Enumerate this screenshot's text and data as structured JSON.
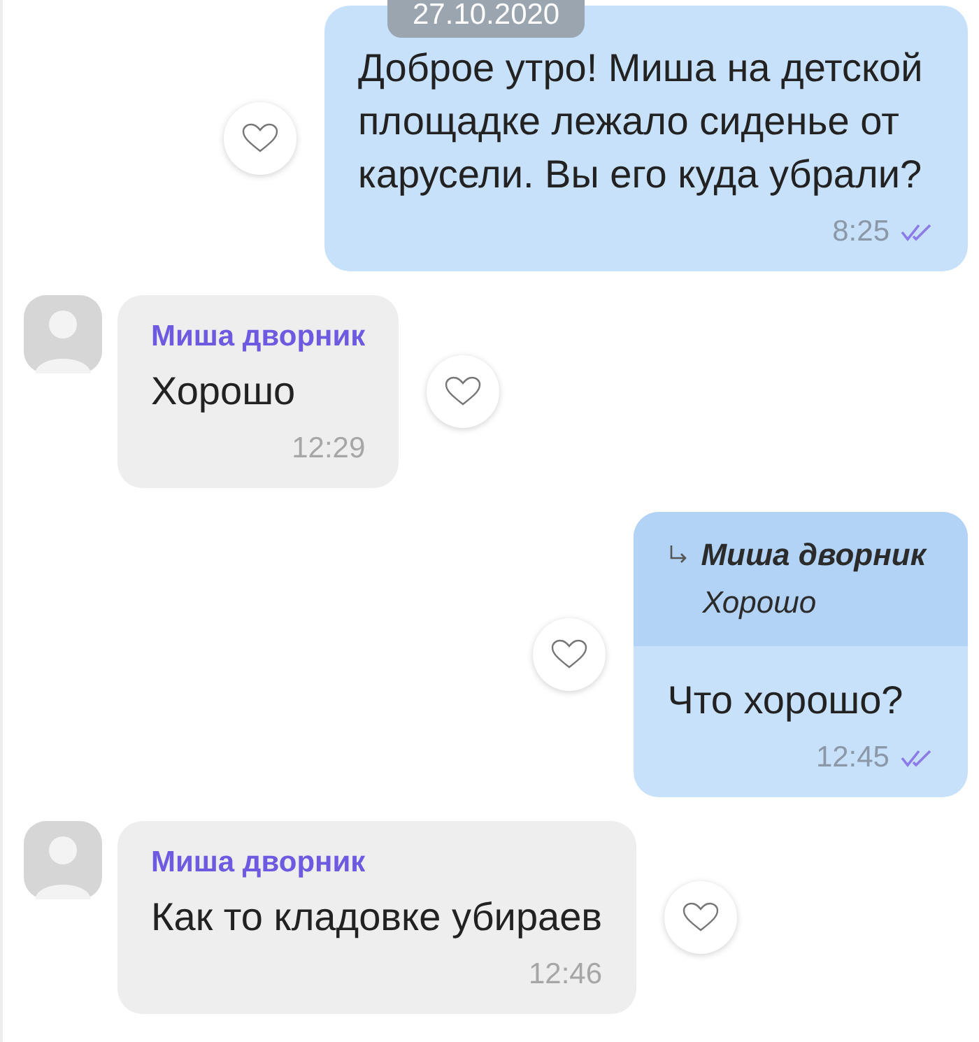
{
  "date_badge": "27.10.2020",
  "messages": [
    {
      "kind": "outgoing",
      "text": "Доброе утро! Миша на детской площадке лежало сиденье от карусели. Вы его куда убрали?",
      "time": "8:25",
      "read": true
    },
    {
      "kind": "incoming",
      "sender": "Миша дворник",
      "text": "Хорошо",
      "time": "12:29"
    },
    {
      "kind": "outgoing",
      "reply": {
        "sender": "Миша дворник",
        "text": "Хорошо"
      },
      "text": "Что хорошо?",
      "time": "12:45",
      "read": true
    },
    {
      "kind": "incoming",
      "sender": "Миша дворник",
      "text": "Как то кладовке убираев",
      "time": "12:46"
    }
  ]
}
